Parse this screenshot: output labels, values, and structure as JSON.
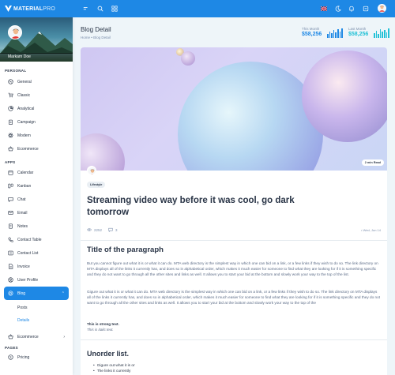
{
  "brand": {
    "name": "MATERIAL",
    "suffix": "PRO"
  },
  "profile": {
    "name": "Markarn Doe"
  },
  "sidebar": {
    "personal_caption": "PERSONAL",
    "personal": [
      {
        "label": "General",
        "icon": "aperture-icon"
      },
      {
        "label": "Classic",
        "icon": "shopping-cart-icon"
      },
      {
        "label": "Analytical",
        "icon": "chart-pie-icon"
      },
      {
        "label": "Campaign",
        "icon": "clipboard-icon"
      },
      {
        "label": "Modern",
        "icon": "atom-icon"
      },
      {
        "label": "Ecommerce",
        "icon": "basket-icon"
      }
    ],
    "apps_caption": "APPS",
    "apps": [
      {
        "label": "Calendar",
        "icon": "calendar-icon"
      },
      {
        "label": "Kanban",
        "icon": "layout-kanban-icon"
      },
      {
        "label": "Chat",
        "icon": "message-icon"
      },
      {
        "label": "Email",
        "icon": "mail-icon"
      },
      {
        "label": "Notes",
        "icon": "notes-icon"
      },
      {
        "label": "Contact Table",
        "icon": "phone-icon"
      },
      {
        "label": "Contact List",
        "icon": "list-details-icon"
      },
      {
        "label": "Invoice",
        "icon": "file-text-icon"
      },
      {
        "label": "User Profile",
        "icon": "user-circle-icon"
      },
      {
        "label": "Blog",
        "icon": "chart-donut-icon"
      }
    ],
    "blog_sub": [
      "Posts",
      "Details"
    ],
    "ecommerce_label": "Ecommerce",
    "pages_caption": "PAGES",
    "pricing_label": "Pricing"
  },
  "topbar": {
    "icons": [
      "menu-icon",
      "search-icon",
      "grid-icon",
      "flag-uk-icon",
      "moon-icon",
      "bell-icon",
      "cart-icon",
      "user-avatar-icon"
    ]
  },
  "header": {
    "title": "Blog Detail",
    "breadcrumb_home": "Home",
    "breadcrumb_sep": "•",
    "breadcrumb_current": "Blog Detail",
    "this_month_label": "This Month",
    "this_month_value": "$58,256",
    "last_month_label": "Last Month",
    "last_month_value": "$58,256"
  },
  "colors": {
    "primary": "#1e88e5",
    "success": "#21c1d6",
    "text": "#2a3547"
  },
  "post": {
    "read_badge": "2 min Read",
    "category": "Lifestyle",
    "title": "Streaming video way before it was cool, go dark tomorrow",
    "views": "2252",
    "comments": "3",
    "date": "Wed, Jun 14",
    "section_title": "Title of the paragraph",
    "para1": "But you cannot figure out what it is or what it can do. MTA web directory is the simplest way in which one can bid on a link, or a few links if they wish to do so. The link directory on MTA displays all of the links it currently has, and does so in alphabetical order, which makes it much easier for someone to find what they are looking for if it is something specific and they do not want to go through all the other sites and links as well. It allows you to start your bid at the bottom and slowly work your way to the top of the list.",
    "para2": "Gigure out what it is or what it can do. MTA web directory is the simplest way in which one can bid on a link, or a few links if they wish to do so. The link directory on MTA displays all of the links it currently has, and does so in alphabetical order, which makes it much easier for someone to find what they are looking for if it is something specific and they do not want to go through all the other sites and links as well. It allows you to start your bid at the bottom and slowly work your way to the top of the",
    "strong_text": "This is strong text.",
    "italic_text": "This is italic text.",
    "list_title": "Unorder list.",
    "list_items": [
      "Gigure out what it is or",
      "The links it currently"
    ]
  }
}
